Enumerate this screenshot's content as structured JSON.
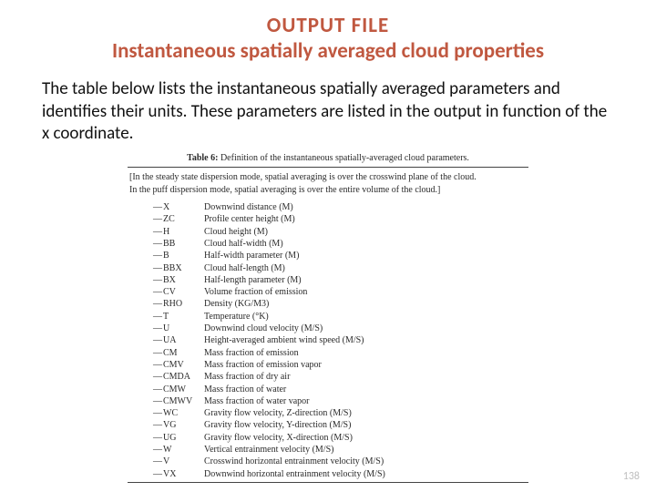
{
  "title": {
    "line1": "OUTPUT FILE",
    "line2": "Instantaneous spatially averaged cloud properties"
  },
  "body": "The table below lists the instantaneous spatially averaged parameters and identifies their units.  These parameters are listed in the output in function of the x coordinate.",
  "table": {
    "caption_label": "Table 6:",
    "caption_text": "Definition of the instantaneous spatially-averaged cloud parameters.",
    "note_line1": "[In the steady state dispersion mode, spatial averaging is over the crosswind plane of the cloud.",
    "note_line2": "In the puff dispersion mode, spatial averaging is over the entire volume of the cloud.]",
    "rows": [
      {
        "symbol": "X",
        "desc": "Downwind distance (M)"
      },
      {
        "symbol": "ZC",
        "desc": "Profile center height (M)"
      },
      {
        "symbol": "H",
        "desc": "Cloud height (M)"
      },
      {
        "symbol": "BB",
        "desc": "Cloud half-width (M)"
      },
      {
        "symbol": "B",
        "desc": "Half-width parameter (M)"
      },
      {
        "symbol": "BBX",
        "desc": "Cloud half-length (M)"
      },
      {
        "symbol": "BX",
        "desc": "Half-length parameter (M)"
      },
      {
        "symbol": "CV",
        "desc": "Volume fraction of emission"
      },
      {
        "symbol": "RHO",
        "desc": "Density (KG/M3)"
      },
      {
        "symbol": "T",
        "desc": "Temperature (°K)"
      },
      {
        "symbol": "U",
        "desc": "Downwind cloud velocity (M/S)"
      },
      {
        "symbol": "UA",
        "desc": "Height-averaged ambient wind speed (M/S)"
      },
      {
        "symbol": "CM",
        "desc": "Mass fraction of emission"
      },
      {
        "symbol": "CMV",
        "desc": "Mass fraction of emission vapor"
      },
      {
        "symbol": "CMDA",
        "desc": "Mass fraction of dry air"
      },
      {
        "symbol": "CMW",
        "desc": "Mass fraction of water"
      },
      {
        "symbol": "CMWV",
        "desc": "Mass fraction of water vapor"
      },
      {
        "symbol": "WC",
        "desc": "Gravity flow velocity, Z-direction (M/S)"
      },
      {
        "symbol": "VG",
        "desc": "Gravity flow velocity, Y-direction (M/S)"
      },
      {
        "symbol": "UG",
        "desc": "Gravity flow velocity, X-direction (M/S)"
      },
      {
        "symbol": "W",
        "desc": "Vertical entrainment velocity (M/S)"
      },
      {
        "symbol": "V",
        "desc": "Crosswind horizontal entrainment velocity (M/S)"
      },
      {
        "symbol": "VX",
        "desc": "Downwind horizontal entrainment velocity (M/S)"
      }
    ]
  },
  "page_number": "138"
}
